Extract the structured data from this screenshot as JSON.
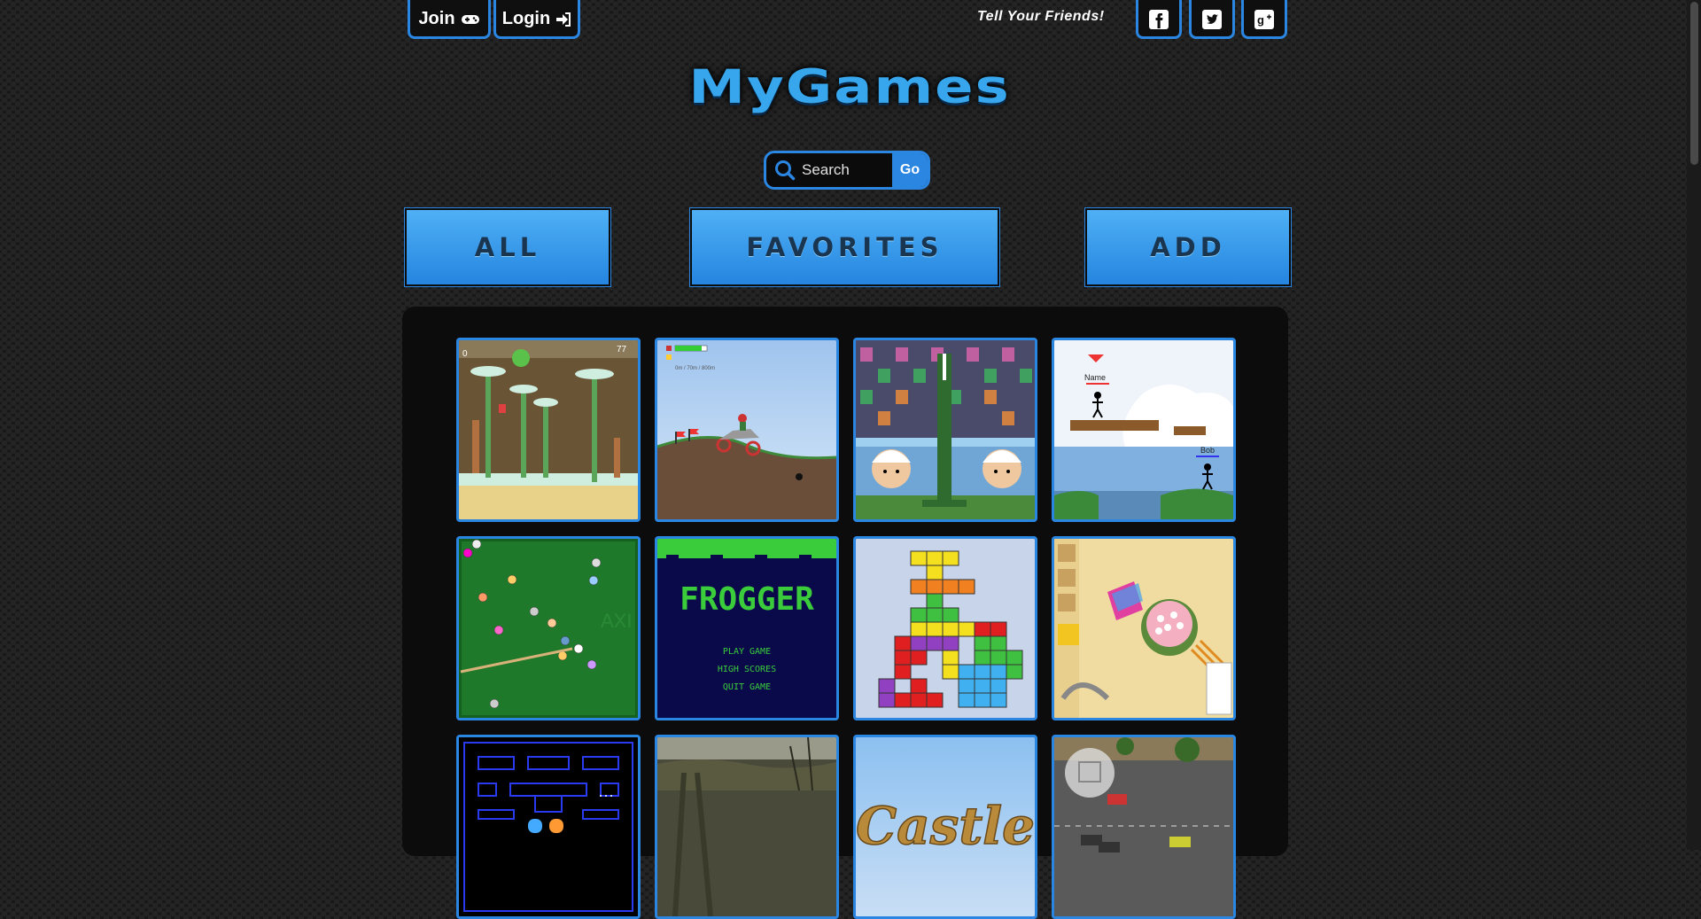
{
  "header": {
    "join_label": "Join",
    "login_label": "Login",
    "friends_label": "Tell Your Friends!",
    "social": [
      {
        "name": "facebook",
        "icon": "facebook-icon"
      },
      {
        "name": "twitter",
        "icon": "twitter-icon"
      },
      {
        "name": "google-plus",
        "icon": "google-plus-icon"
      }
    ]
  },
  "logo": {
    "text": "MyGames"
  },
  "search": {
    "placeholder": "Search",
    "go_label": "Go"
  },
  "nav": {
    "all_label": "ALL",
    "favorites_label": "FAVORITES",
    "add_label": "ADD"
  },
  "games": [
    {
      "name": "platformer",
      "thumb_text": "77",
      "score": "0"
    },
    {
      "name": "hill-racer",
      "thumb_text": "0m / 70m / 800m"
    },
    {
      "name": "head-tennis"
    },
    {
      "name": "stick-platformer",
      "player1": "Name",
      "player2": "Bob"
    },
    {
      "name": "billiards",
      "watermark": "AXI"
    },
    {
      "name": "frogger",
      "title": "FROGGER",
      "menu": [
        "PLAY GAME",
        "HIGH SCORES",
        "QUIT GAME"
      ]
    },
    {
      "name": "blocks"
    },
    {
      "name": "cake-puzzle"
    },
    {
      "name": "pacman"
    },
    {
      "name": "forest-shooter"
    },
    {
      "name": "castle",
      "title": "Castle"
    },
    {
      "name": "parking"
    }
  ],
  "colors": {
    "accent": "#2b86e2",
    "button_top": "#4fb0f5",
    "button_bottom": "#2585e0",
    "background": "#161616"
  }
}
